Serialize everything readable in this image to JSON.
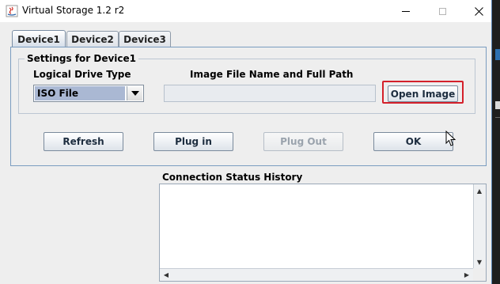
{
  "window": {
    "title": "Virtual Storage 1.2 r2"
  },
  "tabs": [
    {
      "label": "Device1",
      "active": true
    },
    {
      "label": "Device2",
      "active": false
    },
    {
      "label": "Device3",
      "active": false
    }
  ],
  "settings": {
    "group_title": "Settings for Device1",
    "drive_type_label": "Logical Drive Type",
    "drive_type_value": "ISO File",
    "image_path_label": "Image File Name and Full Path",
    "image_path_value": "",
    "open_image_label": "Open Image"
  },
  "buttons": {
    "refresh": "Refresh",
    "plug_in": "Plug in",
    "plug_out": "Plug Out",
    "ok": "OK"
  },
  "status": {
    "title": "Connection Status History"
  },
  "colors": {
    "highlight": "#d4202a",
    "selection": "#aab8d3",
    "panel_border": "#7a9cc0"
  },
  "icons": {
    "app": "java-app-icon",
    "minimize": "minimize-icon",
    "maximize": "maximize-icon",
    "close": "close-icon",
    "dropdown": "chevron-down-icon",
    "cursor": "mouse-cursor-icon"
  }
}
